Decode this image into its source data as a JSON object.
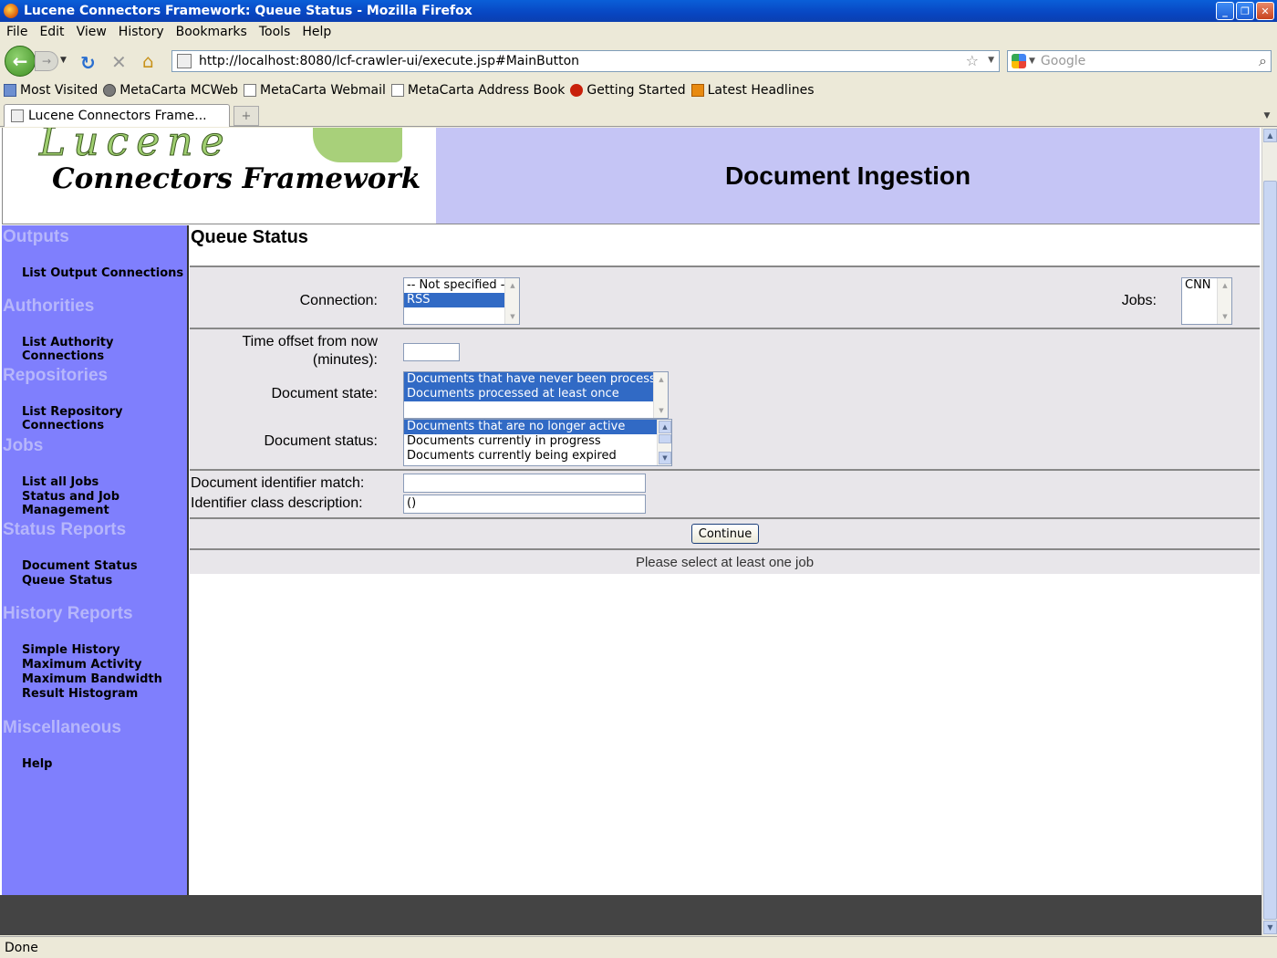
{
  "window": {
    "title": "Lucene Connectors Framework: Queue Status - Mozilla Firefox",
    "minimize": "_",
    "maximize": "❐",
    "close": "✕"
  },
  "menu": [
    "File",
    "Edit",
    "View",
    "History",
    "Bookmarks",
    "Tools",
    "Help"
  ],
  "nav": {
    "url": "http://localhost:8080/lcf-crawler-ui/execute.jsp#MainButton",
    "search_placeholder": "Google"
  },
  "bookmarks": [
    {
      "label": "Most Visited",
      "icon": "folder-icon"
    },
    {
      "label": "MetaCarta MCWeb",
      "icon": "globe-icon"
    },
    {
      "label": "MetaCarta Webmail",
      "icon": "page-icon"
    },
    {
      "label": "MetaCarta Address Book",
      "icon": "page-icon"
    },
    {
      "label": "Getting Started",
      "icon": "getting-started-icon"
    },
    {
      "label": "Latest Headlines",
      "icon": "rss-icon"
    }
  ],
  "tab": {
    "label": "Lucene Connectors Frame...",
    "new_tab": "+"
  },
  "header": {
    "brand": "Lucene",
    "subtitle": "Connectors Framework",
    "title": "Document Ingestion"
  },
  "sidebar": {
    "sections": [
      {
        "title": "Outputs",
        "links": [
          "List Output Connections"
        ]
      },
      {
        "title": "Authorities",
        "links": [
          "List Authority Connections"
        ]
      },
      {
        "title": "Repositories",
        "links": [
          "List Repository Connections"
        ]
      },
      {
        "title": "Jobs",
        "links": [
          "List all Jobs",
          "Status and Job Management"
        ]
      },
      {
        "title": "Status Reports",
        "links": [
          "Document Status",
          "Queue Status"
        ]
      },
      {
        "title": "History Reports",
        "links": [
          "Simple History",
          "Maximum Activity",
          "Maximum Bandwidth",
          "Result Histogram"
        ]
      },
      {
        "title": "Miscellaneous",
        "links": [
          "Help"
        ]
      }
    ]
  },
  "main": {
    "title": "Queue Status",
    "connection_label": "Connection:",
    "connection_options": [
      "-- Not specified --",
      "RSS"
    ],
    "connection_selected": "RSS",
    "jobs_label": "Jobs:",
    "jobs_options": [
      "CNN"
    ],
    "time_offset_label_1": "Time offset from now",
    "time_offset_label_2": "(minutes):",
    "time_offset_value": "",
    "doc_state_label": "Document state:",
    "doc_state_options": [
      "Documents that have never been processed",
      "Documents processed at least once"
    ],
    "doc_status_label": "Document status:",
    "doc_status_options": [
      "Documents that are no longer active",
      "Documents currently in progress",
      "Documents currently being expired"
    ],
    "doc_id_match_label": "Document identifier match:",
    "doc_id_match_value": "",
    "id_class_label": "Identifier class description:",
    "id_class_value": "()",
    "continue_button": "Continue",
    "message": "Please select at least one job"
  },
  "status": "Done"
}
